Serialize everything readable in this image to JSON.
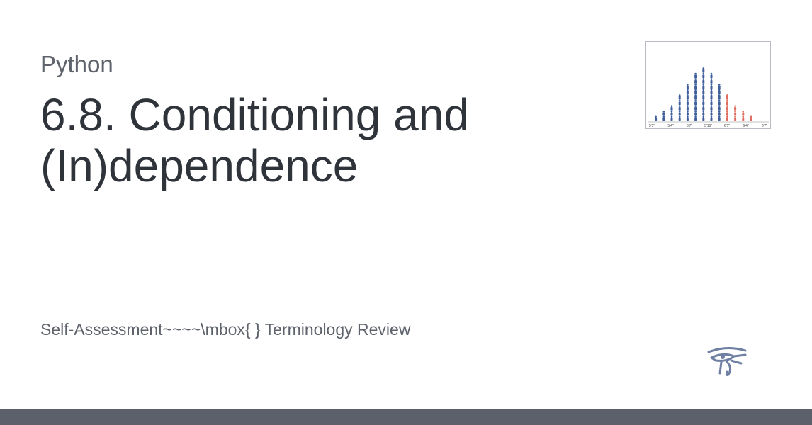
{
  "card": {
    "kicker": "Python",
    "title": "6.8. Conditioning and (In)dependence",
    "subtitle": "Self-Assessment~~~~\\mbox{ } Terminology Review"
  },
  "thumbnail": {
    "ticks": [
      "5'1\"",
      "5'4\"",
      "5'7\"",
      "5'10\"",
      "6'1\"",
      "6'4\"",
      "6'7\""
    ],
    "counts": [
      1,
      2,
      3,
      5,
      7,
      9,
      10,
      9,
      7,
      5,
      3,
      2,
      1
    ],
    "highlight_from": 9,
    "colors": {
      "base": "#3f5f9b",
      "highlight": "#e06b5e"
    }
  },
  "logo": {
    "icon": "eye-of-horus-icon",
    "color": "#6f7fa3"
  },
  "colors": {
    "footer": "#5b606a",
    "text_dark": "#2f333a",
    "text_muted": "#5d626b"
  }
}
